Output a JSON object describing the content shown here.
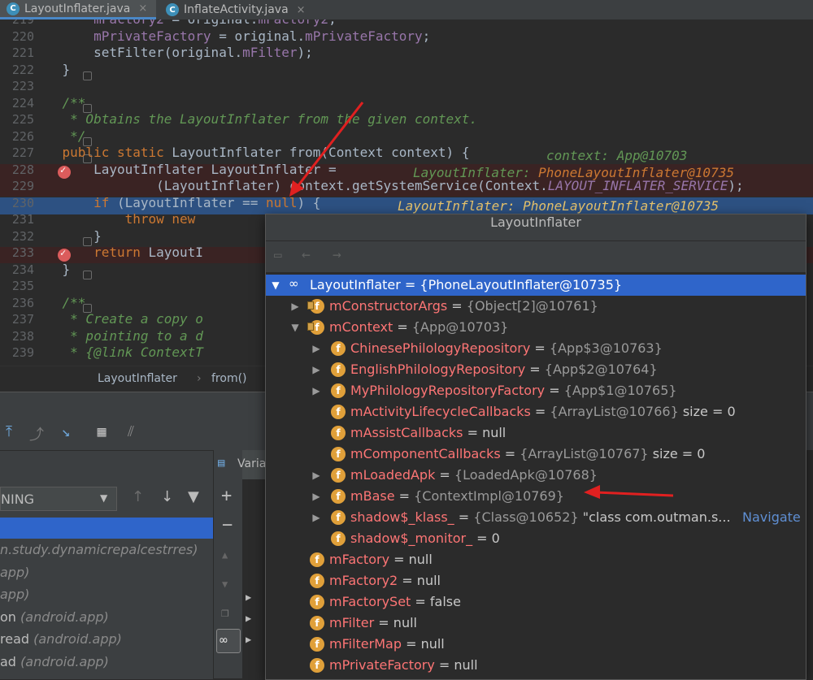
{
  "tabs": [
    {
      "label": "LayoutInflater.java",
      "close": "×",
      "active": true
    },
    {
      "label": "InflateActivity.java",
      "close": "×",
      "active": false
    }
  ],
  "code_lines": [
    {
      "num": "219",
      "text": "        mFactory2 = original.mFactory2;"
    },
    {
      "num": "220",
      "text": "        mPrivateFactory = original.mPrivateFactory;"
    },
    {
      "num": "221",
      "text": "        setFilter(original.mFilter);"
    },
    {
      "num": "222",
      "text": "    }"
    },
    {
      "num": "223",
      "text": ""
    },
    {
      "num": "224",
      "text": "    /**"
    },
    {
      "num": "225",
      "text": "     * Obtains the LayoutInflater from the given context."
    },
    {
      "num": "226",
      "text": "     */"
    },
    {
      "num": "227",
      "text": "    public static LayoutInflater from(Context context) {"
    },
    {
      "num": "228",
      "text": "        LayoutInflater LayoutInflater ="
    },
    {
      "num": "229",
      "text": "                (LayoutInflater) context.getSystemService(Context.LAYOUT_INFLATER_SERVICE);"
    },
    {
      "num": "230",
      "text": "        if (LayoutInflater == null) {"
    },
    {
      "num": "231",
      "text": "            throw new"
    },
    {
      "num": "232",
      "text": "        }"
    },
    {
      "num": "233",
      "text": "        return LayoutI"
    },
    {
      "num": "234",
      "text": "    }"
    },
    {
      "num": "235",
      "text": ""
    },
    {
      "num": "236",
      "text": "    /**"
    },
    {
      "num": "237",
      "text": "     * Create a copy o"
    },
    {
      "num": "238",
      "text": "     * pointing to a d"
    },
    {
      "num": "239",
      "text": "     * {@link ContextT"
    }
  ],
  "inline_hints": {
    "h227": "context: App@10703",
    "h228_label": "LayoutInflater:",
    "h228_value": "PhoneLayoutInflater@10735",
    "h230_label": "LayoutInflater:",
    "h230_value": "PhoneLayoutInflater@10735"
  },
  "breadcrumb": {
    "class": "LayoutInflater",
    "sep": "›",
    "method": "from()"
  },
  "debug": {
    "variables_tab": "Varia",
    "thread_select": "NING",
    "frames": [
      {
        "main": "n.study.dynamicrepalcestrres)",
        "pkg": ""
      },
      {
        "main": "app)",
        "pkg": ""
      },
      {
        "main": "app)",
        "pkg": ""
      },
      {
        "main": "on",
        "pkg": "(android.app)"
      },
      {
        "main": "read",
        "pkg": "(android.app)"
      },
      {
        "main": "ad",
        "pkg": "(android.app)"
      }
    ]
  },
  "popup": {
    "title": "LayoutInflater",
    "root": {
      "name": "LayoutInflater",
      "eq": " = ",
      "value": "{PhoneLayoutInflater@10735}"
    },
    "rows": [
      {
        "name": "mConstructorArgs",
        "eq": " = ",
        "value": "{Object[2]@10761}",
        "extra": ""
      },
      {
        "name": "mContext",
        "eq": " = ",
        "value": "{App@10703}",
        "extra": ""
      },
      {
        "name": "ChinesePhilologyRepository",
        "eq": " = ",
        "value": "{App$3@10763}",
        "extra": ""
      },
      {
        "name": "EnglishPhilologyRepository",
        "eq": " = ",
        "value": "{App$2@10764}",
        "extra": ""
      },
      {
        "name": "MyPhilologyRepositoryFactory",
        "eq": " = ",
        "value": "{App$1@10765}",
        "extra": ""
      },
      {
        "name": "mActivityLifecycleCallbacks",
        "eq": " = ",
        "value": "{ArrayList@10766}",
        "extra": "  size = 0"
      },
      {
        "name": "mAssistCallbacks",
        "eq": " = ",
        "value": "null",
        "extra": ""
      },
      {
        "name": "mComponentCallbacks",
        "eq": " = ",
        "value": "{ArrayList@10767}",
        "extra": "  size = 0"
      },
      {
        "name": "mLoadedApk",
        "eq": " = ",
        "value": "{LoadedApk@10768}",
        "extra": ""
      },
      {
        "name": "mBase",
        "eq": " = ",
        "value": "{ContextImpl@10769}",
        "extra": ""
      },
      {
        "name": "shadow$_klass_",
        "eq": " = ",
        "value": "{Class@10652}",
        "extra": " \"class com.outman.s..."
      },
      {
        "name": "shadow$_monitor_",
        "eq": " = ",
        "value": "0",
        "extra": ""
      },
      {
        "name": "mFactory",
        "eq": " = ",
        "value": "null",
        "extra": ""
      },
      {
        "name": "mFactory2",
        "eq": " = ",
        "value": "null",
        "extra": ""
      },
      {
        "name": "mFactorySet",
        "eq": " = ",
        "value": "false",
        "extra": ""
      },
      {
        "name": "mFilter",
        "eq": " = ",
        "value": "null",
        "extra": ""
      },
      {
        "name": "mFilterMap",
        "eq": " = ",
        "value": "null",
        "extra": ""
      },
      {
        "name": "mPrivateFactory",
        "eq": " = ",
        "value": "null",
        "extra": ""
      }
    ],
    "navigate": "Navigate"
  },
  "icons": {
    "field": "f",
    "class": "C",
    "annotation_color": "#e02020"
  }
}
